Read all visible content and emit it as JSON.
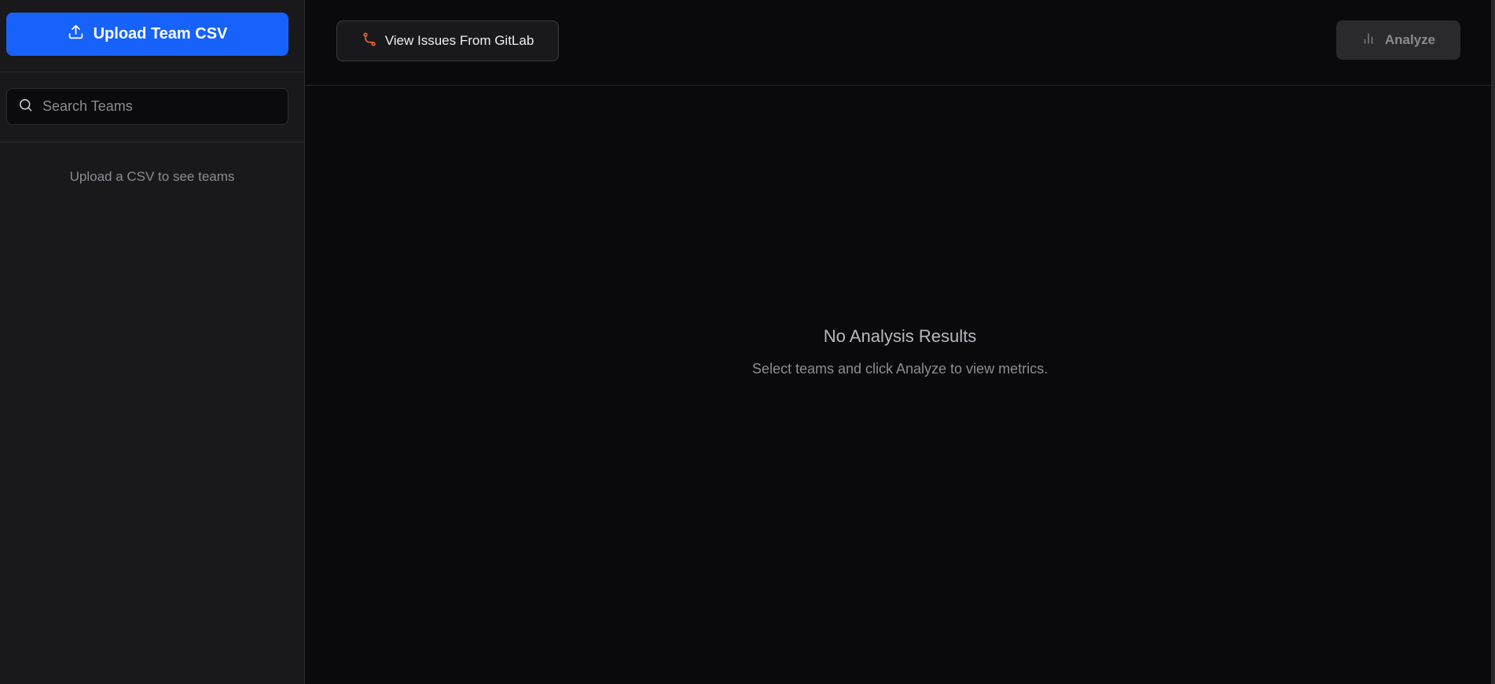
{
  "sidebar": {
    "upload_label": "Upload Team CSV",
    "upload_icon": "upload-icon",
    "search_placeholder": "Search Teams",
    "search_value": "",
    "search_icon": "search-icon",
    "empty_message": "Upload a CSV to see teams"
  },
  "toolbar": {
    "gitlab_label": "View Issues From GitLab",
    "gitlab_icon": "git-merge-icon",
    "analyze_label": "Analyze",
    "analyze_icon": "bar-chart-icon"
  },
  "main": {
    "empty_title": "No Analysis Results",
    "empty_subtitle": "Select teams and click Analyze to view metrics."
  },
  "colors": {
    "accent": "#1762fb",
    "gitlab_icon": "#e8682c",
    "sidebar_bg": "#19191b",
    "main_bg": "#0a0a0c"
  }
}
